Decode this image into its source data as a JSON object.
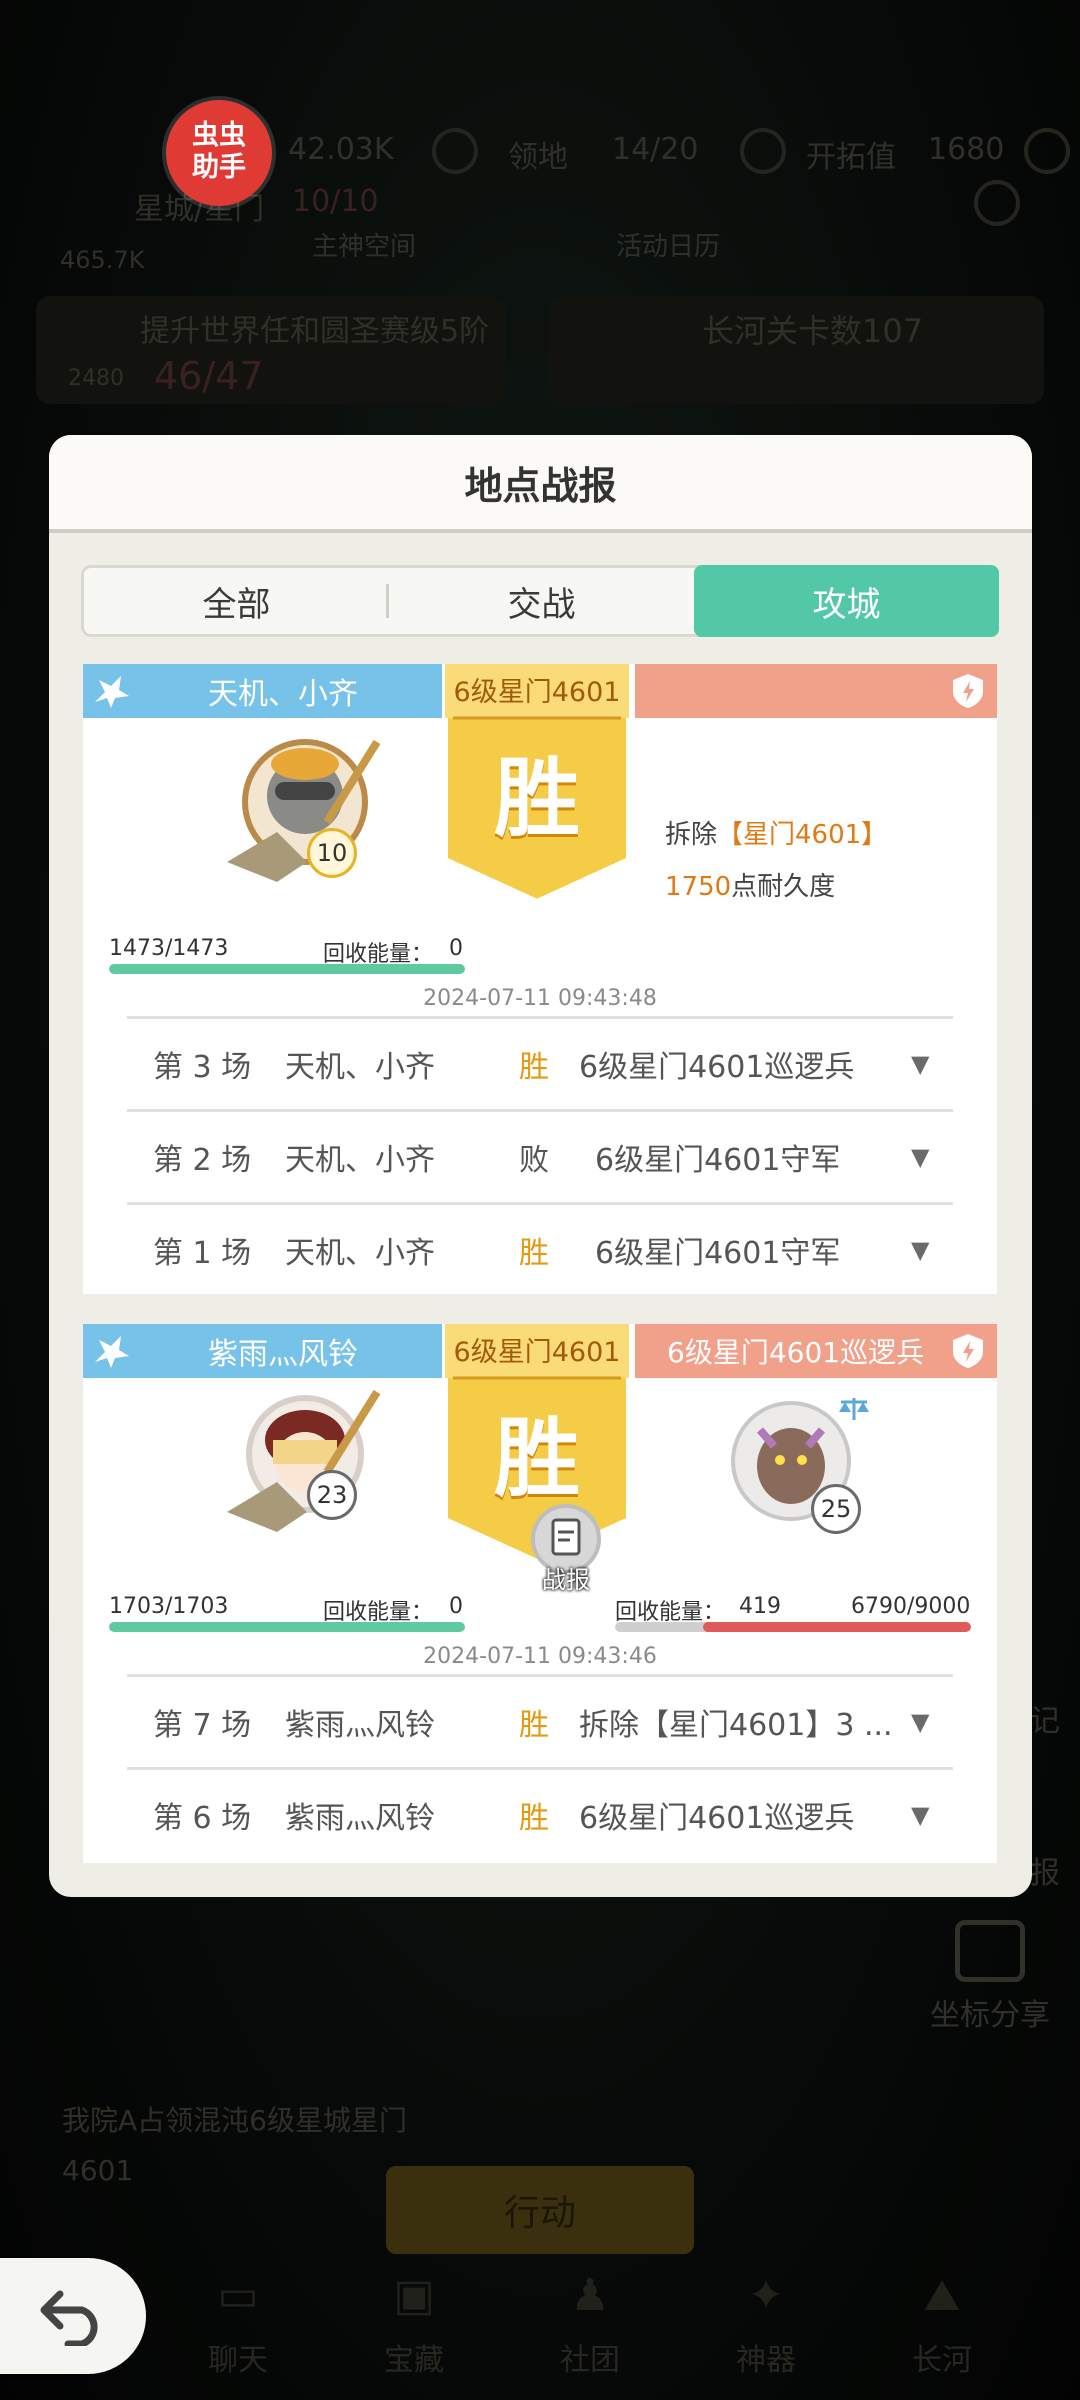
{
  "background": {
    "resource_value": "42.03K",
    "territory_label": "领地",
    "territory_count": "14/20",
    "pioneer_label": "开拓值",
    "pioneer_value": "1680",
    "star_city_label": "星城/星门",
    "star_city_count": "10/10",
    "main_god_space": "主神空间",
    "activity_calendar": "活动日历",
    "secondary_value": "465.7K",
    "task_text": "提升世界任和圆圣赛级5阶",
    "task_progress": "46/47",
    "task_small": "2480",
    "river_text": "长河关卡数107",
    "event_text": "我院A占领混沌6级星城星门4601",
    "action_label": "行动",
    "share_label": "坐标分享",
    "side_label_1": "记",
    "side_label_2": "报",
    "nav": [
      "聊天",
      "宝藏",
      "社团",
      "神器",
      "长河"
    ]
  },
  "helper_badge": [
    "虫虫",
    "助手"
  ],
  "modal": {
    "title": "地点战报",
    "tabs": [
      "全部",
      "交战",
      "攻城"
    ],
    "active_tab": "攻城"
  },
  "reports": [
    {
      "attacker": "天机、小齐",
      "location": "6级星门4601",
      "result": "胜",
      "defender": "",
      "attacker_level": "10",
      "attacker_hp": "1473/1473",
      "recycle_label": "回收能量：",
      "attacker_recycle": "0",
      "demolish_prefix": "拆除",
      "demolish_target": "【星门4601】",
      "durability_value": "1750",
      "durability_suffix": "点耐久度",
      "time": "2024-07-11 09:43:48",
      "battles": [
        {
          "round": "第 3 场",
          "name": "天机、小齐",
          "result": "胜",
          "target": "6级星门4601巡逻兵"
        },
        {
          "round": "第 2 场",
          "name": "天机、小齐",
          "result": "败",
          "target": "6级星门4601守军"
        },
        {
          "round": "第 1 场",
          "name": "天机、小齐",
          "result": "胜",
          "target": "6级星门4601守军"
        }
      ]
    },
    {
      "attacker": "紫雨灬风铃",
      "location": "6级星门4601",
      "result": "胜",
      "defender": "6级星门4601巡逻兵",
      "attacker_level": "23",
      "defender_level": "25",
      "attacker_hp": "1703/1703",
      "recycle_label": "回收能量：",
      "attacker_recycle": "0",
      "defender_recycle": "419",
      "defender_hp": "6790/9000",
      "defender_hp_fraction": 0.754,
      "report_label": "战报",
      "time": "2024-07-11 09:43:46",
      "battles": [
        {
          "round": "第 7 场",
          "name": "紫雨灬风铃",
          "result": "胜",
          "target": "拆除【星门4601】3 ..."
        },
        {
          "round": "第 6 场",
          "name": "紫雨灬风铃",
          "result": "胜",
          "target": "6级星门4601巡逻兵"
        }
      ]
    }
  ],
  "colors": {
    "accent_teal": "#52c8a6",
    "ribbon_blue": "#76c2e8",
    "ribbon_salmon": "#f1a08a",
    "victory_gold": "#f7c23a",
    "win_text": "#e39a10"
  }
}
